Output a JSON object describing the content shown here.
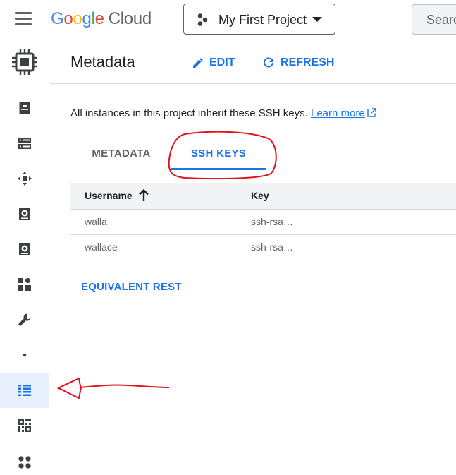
{
  "topbar": {
    "logo": {
      "letters": [
        "G",
        "o",
        "o",
        "g",
        "l",
        "e"
      ],
      "product": "Cloud"
    },
    "project_name": "My First Project",
    "search_placeholder": "Search"
  },
  "header": {
    "title": "Metadata",
    "edit_label": "EDIT",
    "refresh_label": "REFRESH"
  },
  "info": {
    "text": "All instances in this project inherit these SSH keys.",
    "learn_more": "Learn more"
  },
  "tabs": [
    {
      "label": "METADATA",
      "active": false
    },
    {
      "label": "SSH KEYS",
      "active": true
    }
  ],
  "table": {
    "columns": [
      "Username",
      "Key"
    ],
    "sort": "ascending",
    "rows": [
      {
        "username": "walla",
        "key": "ssh-rsa…"
      },
      {
        "username": "wallace",
        "key": "ssh-rsa…"
      }
    ]
  },
  "equivalent_rest": "EQUIVALENT REST",
  "leftnav": {
    "items": [
      "compute-engine-icon",
      "vm-instances-icon",
      "instance-templates-icon",
      "instance-groups-icon",
      "disks-icon",
      "snapshots-icon",
      "images-icon",
      "settings-wrench-icon",
      "dot-icon",
      "metadata-icon",
      "os-patch-icon",
      "more-icon"
    ],
    "active": "metadata-icon"
  },
  "colors": {
    "accent": "#1a73e8",
    "annotation": "#e0121a",
    "active_nav_bg": "#e8f0fe"
  }
}
